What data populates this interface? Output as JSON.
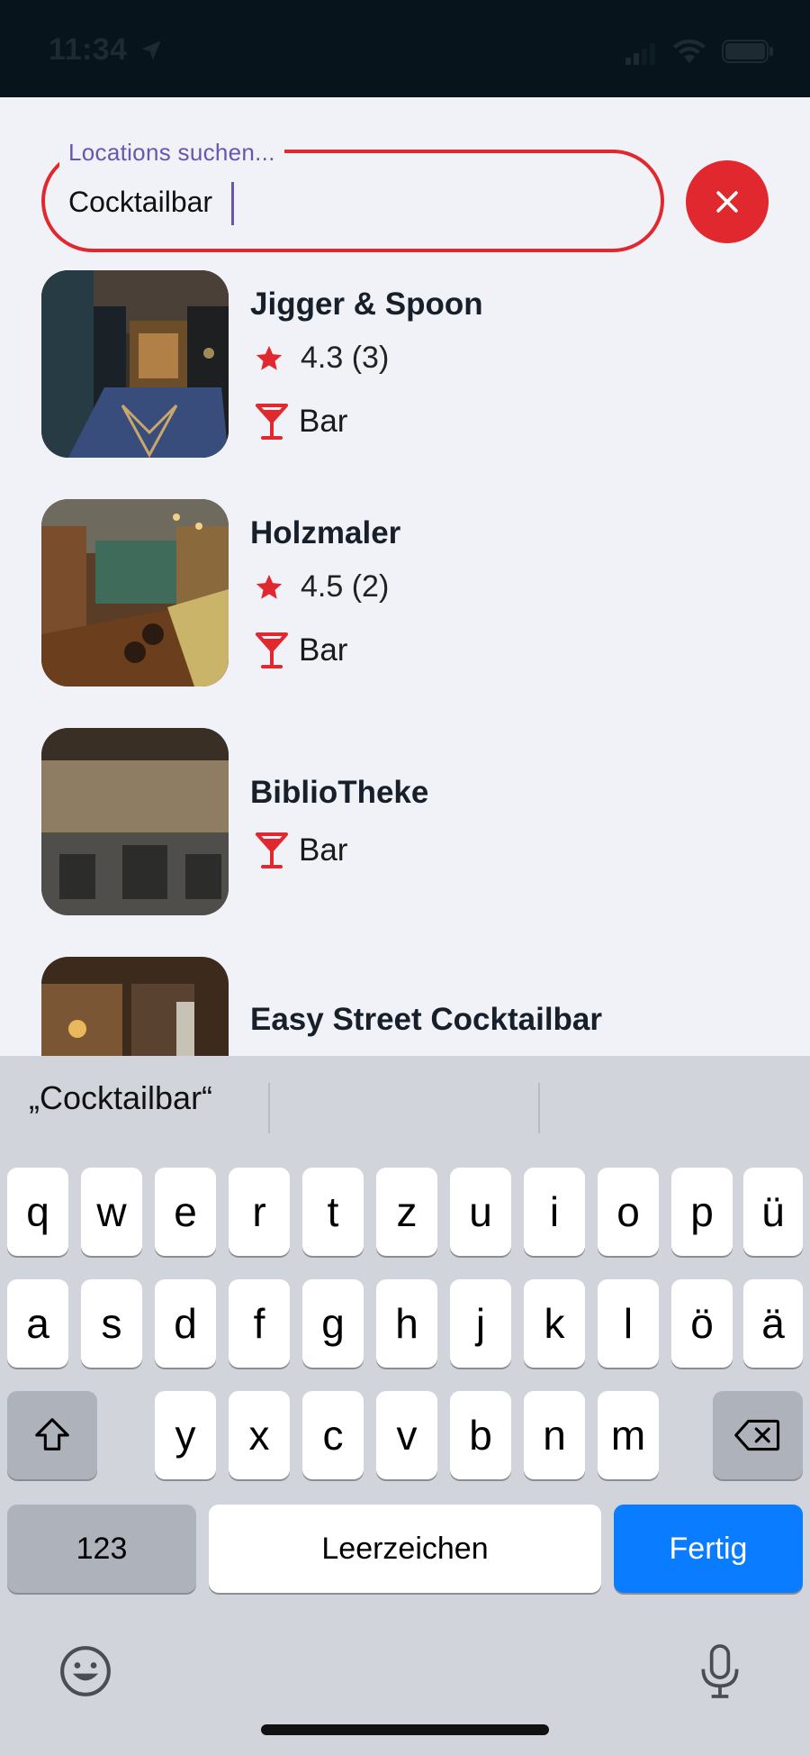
{
  "status_bar": {
    "time": "11:34"
  },
  "search": {
    "label": "Locations suchen...",
    "value": "Cocktailbar"
  },
  "results": [
    {
      "name": "Jigger & Spoon",
      "rating": "4.3 (3)",
      "category": "Bar"
    },
    {
      "name": "Holzmaler",
      "rating": "4.5 (2)",
      "category": "Bar"
    },
    {
      "name": "BiblioTheke",
      "category": "Bar"
    },
    {
      "name": "Easy Street Cocktailbar"
    }
  ],
  "keyboard": {
    "suggestion": "„Cocktailbar“",
    "row1": [
      "q",
      "w",
      "e",
      "r",
      "t",
      "z",
      "u",
      "i",
      "o",
      "p",
      "ü"
    ],
    "row2": [
      "a",
      "s",
      "d",
      "f",
      "g",
      "h",
      "j",
      "k",
      "l",
      "ö",
      "ä"
    ],
    "row3": [
      "y",
      "x",
      "c",
      "v",
      "b",
      "n",
      "m"
    ],
    "numbers_label": "123",
    "space_label": "Leerzeichen",
    "done_label": "Fertig"
  },
  "colors": {
    "accent": "#e0282e",
    "label": "#6a56b0",
    "keyboard_done": "#0a7cff"
  },
  "icons": [
    "location-arrow-icon",
    "signal-icon",
    "wifi-icon",
    "battery-icon",
    "close-icon",
    "star-icon",
    "cocktail-icon",
    "shift-icon",
    "backspace-icon",
    "emoji-icon",
    "microphone-icon"
  ]
}
